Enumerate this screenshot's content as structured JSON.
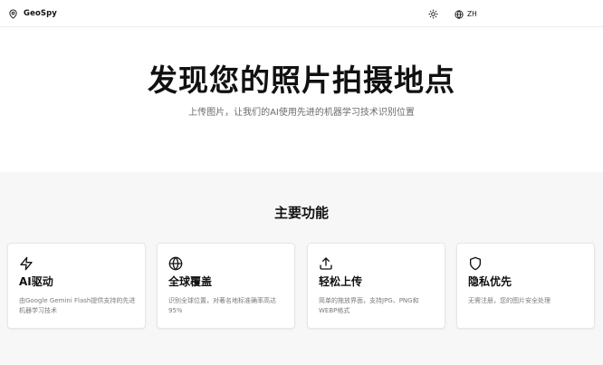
{
  "header": {
    "brand_name": "GeoSpy",
    "brand_icon": "map-pin-icon",
    "theme_icon": "sun-icon",
    "language_icon": "globe-icon",
    "language_label": "ZH"
  },
  "hero": {
    "title": "发现您的照片拍摄地点",
    "subtitle": "上传图片，让我们的AI使用先进的机器学习技术识别位置"
  },
  "features": {
    "title": "主要功能",
    "cards": [
      {
        "icon": "zap-icon",
        "title": "AI驱动",
        "description": "由Google Gemini Flash提供支持的先进机器学习技术"
      },
      {
        "icon": "globe-icon",
        "title": "全球覆盖",
        "description": "识别全球位置，对著名地标准确率高达95%"
      },
      {
        "icon": "upload-icon",
        "title": "轻松上传",
        "description": "简单的拖放界面，支持JPG、PNG和WEBP格式"
      },
      {
        "icon": "shield-icon",
        "title": "隐私优先",
        "description": "无需注册，您的图片安全处理"
      }
    ]
  },
  "colors": {
    "text": "#111111",
    "muted": "#6b6b6b",
    "section_bg": "#f7f7f7",
    "card_border": "#e6e6e6"
  }
}
